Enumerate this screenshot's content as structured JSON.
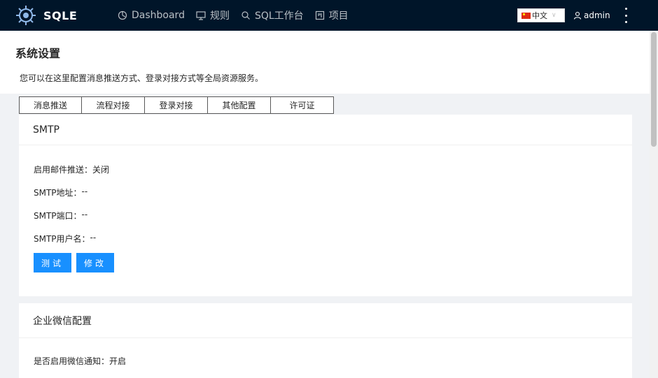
{
  "header": {
    "logo_text": "SQLE",
    "nav": [
      {
        "label": "Dashboard",
        "icon": "dashboard-icon"
      },
      {
        "label": "规则",
        "icon": "desktop-icon"
      },
      {
        "label": "SQL工作台",
        "icon": "search-icon"
      },
      {
        "label": "项目",
        "icon": "project-icon"
      }
    ],
    "language": "中文",
    "username": "admin"
  },
  "page": {
    "title": "系统设置",
    "description": "您可以在这里配置消息推送方式、登录对接方式等全局资源服务。"
  },
  "tabs": [
    "消息推送",
    "流程对接",
    "登录对接",
    "其他配置",
    "许可证"
  ],
  "smtp": {
    "title": "SMTP",
    "fields": [
      {
        "label": "启用邮件推送：",
        "value": "关闭"
      },
      {
        "label": "SMTP地址：",
        "value": "--"
      },
      {
        "label": "SMTP端口：",
        "value": "--"
      },
      {
        "label": "SMTP用户名：",
        "value": "--"
      }
    ],
    "test_label": "测试",
    "edit_label": "修改"
  },
  "wechat": {
    "title": "企业微信配置",
    "fields": [
      {
        "label": "是否启用微信通知：",
        "value": "开启"
      }
    ]
  },
  "colors": {
    "header_bg": "#001529",
    "primary": "#1890ff",
    "content_bg": "#f0f2f5"
  }
}
